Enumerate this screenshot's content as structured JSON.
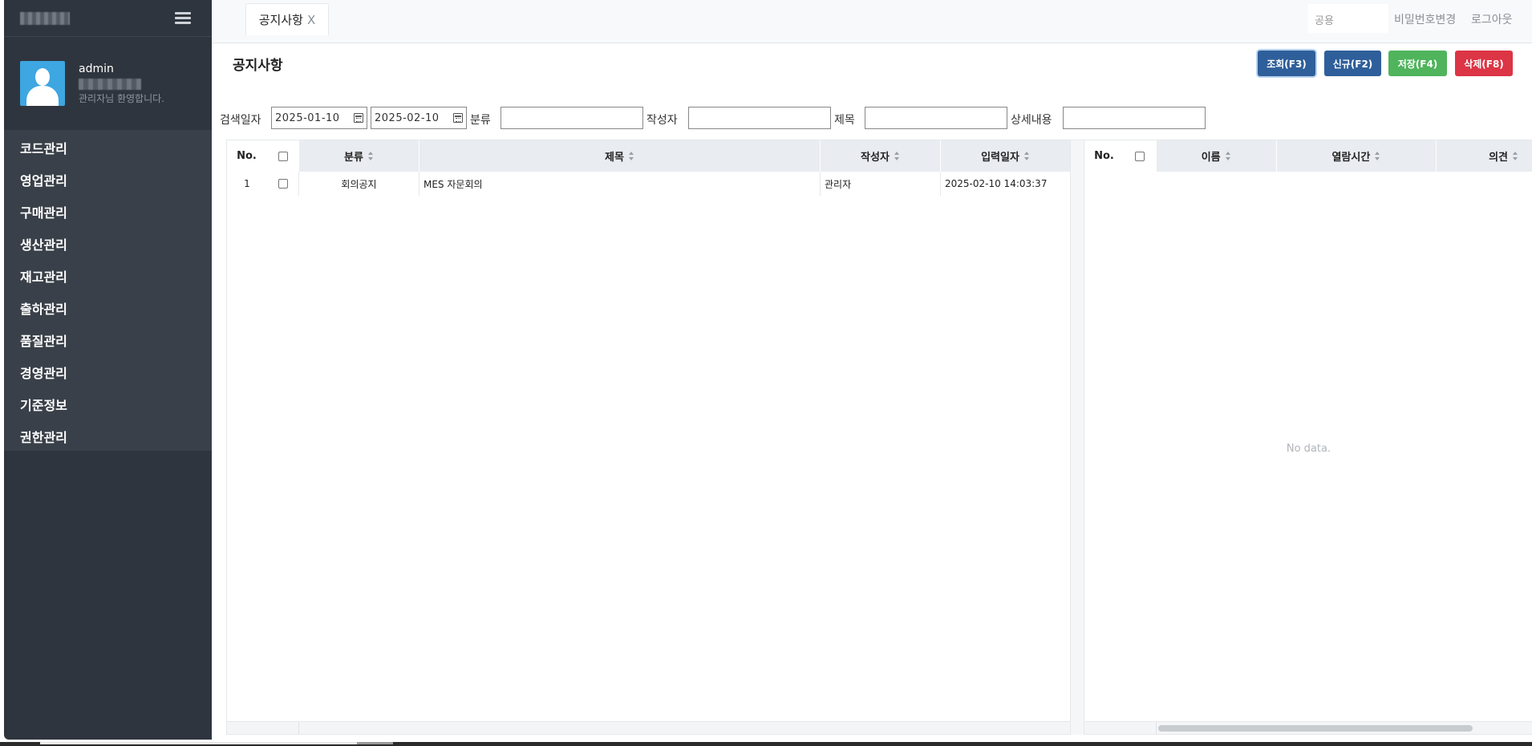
{
  "sidebar": {
    "user": {
      "name": "admin",
      "welcome": "관리자님 환영합니다."
    },
    "menu": [
      {
        "label": "코드관리"
      },
      {
        "label": "영업관리"
      },
      {
        "label": "구매관리"
      },
      {
        "label": "생산관리"
      },
      {
        "label": "재고관리"
      },
      {
        "label": "출하관리"
      },
      {
        "label": "품질관리"
      },
      {
        "label": "경영관리"
      },
      {
        "label": "기준정보"
      },
      {
        "label": "권한관리"
      }
    ]
  },
  "topbar": {
    "tab": {
      "label": "공지사항",
      "close": "X"
    },
    "company_select": "공용",
    "change_password": "비밀번호변경",
    "logout": "로그아웃"
  },
  "page": {
    "title": "공지사항",
    "buttons": {
      "query": "조회(F3)",
      "new": "신규(F2)",
      "save": "저장(F4)",
      "delete": "삭제(F8)"
    }
  },
  "search": {
    "date_label": "검색일자",
    "date_from": "2025-01-10",
    "date_to": "2025-02-10",
    "category_label": "분류",
    "author_label": "작성자",
    "subject_label": "제목",
    "detail_label": "상세내용"
  },
  "notice_grid": {
    "headers": {
      "no": "No.",
      "category": "분류",
      "subject": "제목",
      "author": "작성자",
      "date": "입력일자"
    },
    "rows": [
      {
        "no": "1",
        "category": "회의공지",
        "subject": "MES 자문회의",
        "author": "관리자",
        "date": "2025-02-10 14:03:37"
      }
    ]
  },
  "reader_grid": {
    "headers": {
      "no": "No.",
      "name": "이름",
      "read_time": "열람시간",
      "opinion": "의견"
    },
    "empty_text": "No data."
  },
  "colors": {
    "sidebar_bg": "#2f353e",
    "nav_bg": "#3a4049",
    "primary": "#2f5f9a",
    "success": "#4fb45c",
    "danger": "#dc3545",
    "avatar": "#3ea6e1"
  }
}
